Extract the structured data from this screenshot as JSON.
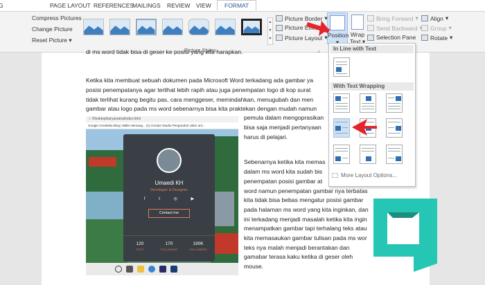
{
  "ribbon_tabs": [
    "PAGE LAYOUT",
    "REFERENCES",
    "MAILINGS",
    "REVIEW",
    "VIEW",
    "FORMAT"
  ],
  "ribbon_tab_partial": "G",
  "adjust": {
    "compress": "Compress Pictures",
    "change": "Change Picture",
    "reset": "Reset Picture"
  },
  "picture_styles_label": "Picture Styles",
  "picture_format": {
    "border": "Picture Border",
    "effects": "Picture Effects",
    "layout": "Picture Layout"
  },
  "arrange": {
    "position": "Position",
    "wrap_text_1": "Wrap",
    "wrap_text_2": "Text",
    "bring_forward": "Bring Forward",
    "send_backward": "Send Backward",
    "selection_pane": "Selection Pane",
    "align": "Align",
    "group": "Group",
    "rotate": "Rotate"
  },
  "dropdown": {
    "in_line": "In Line with Text",
    "with_wrapping": "With Text Wrapping",
    "more": "More Layout Options..."
  },
  "doc": {
    "line0": "di ms word tidak bisa di geser ke posisi yang kita harapkan.",
    "para1": [
      "Ketika kita membuat sebuah dokumen pada Microsoft Word terkadang ada gambar ya",
      "posisi penempatanya agar terlihat lebih rapih atau juga penempatan logo di kop surat",
      "tidak terlihat kurang begitu pas, cara menggeser, memindahkan, menugubah dan men",
      "gambar atau logo pada ms word sebenarnya bisa kita praktekan dengan mudah namun"
    ],
    "para1_wrap": [
      "pemula dalam mengoprasikan",
      "bisa saja menjadi pertanyaan",
      "harus di pelajari."
    ],
    "para2": [
      "Sebenarnya ketika kita memas",
      "dalam ms word kita sudah bis",
      "penempatan posisi gambar at",
      "word namun penempatan gambar nya terbatas",
      "kita tidak bisa bebas mengatur posisi gambar",
      "pada halaman ms word yang kita inginkan, dan",
      "ini terkadang menjadi masalah ketika kita ingin",
      "menampatkan gambar tapi terhalang teks atau",
      "kita memasaukan gambar tulisan pada ms wor",
      "teks nya malah menjadi berantakan dan",
      "gamabar terasa kaku ketika di geser oleh",
      "mouse."
    ]
  },
  "screenshot": {
    "url": "/Desktop/karyanama/index.html",
    "bookmarks": "Google Cendekia   Bing | Bitkin Menang...   (1) Creator Studio   Pengunduh video onl...",
    "name": "Umaedi KH",
    "role": "Developer & Designer",
    "contact": "Contact me",
    "stats": [
      {
        "value": "120",
        "label": "POST"
      },
      {
        "value": "170",
        "label": "FOLLOWING"
      },
      {
        "value": "190K",
        "label": "FOLLOWERS"
      }
    ]
  },
  "colors": {
    "accent_red": "#e3242b",
    "logo_teal": "#26c6b5",
    "logo_dark": "#1c8f82"
  }
}
